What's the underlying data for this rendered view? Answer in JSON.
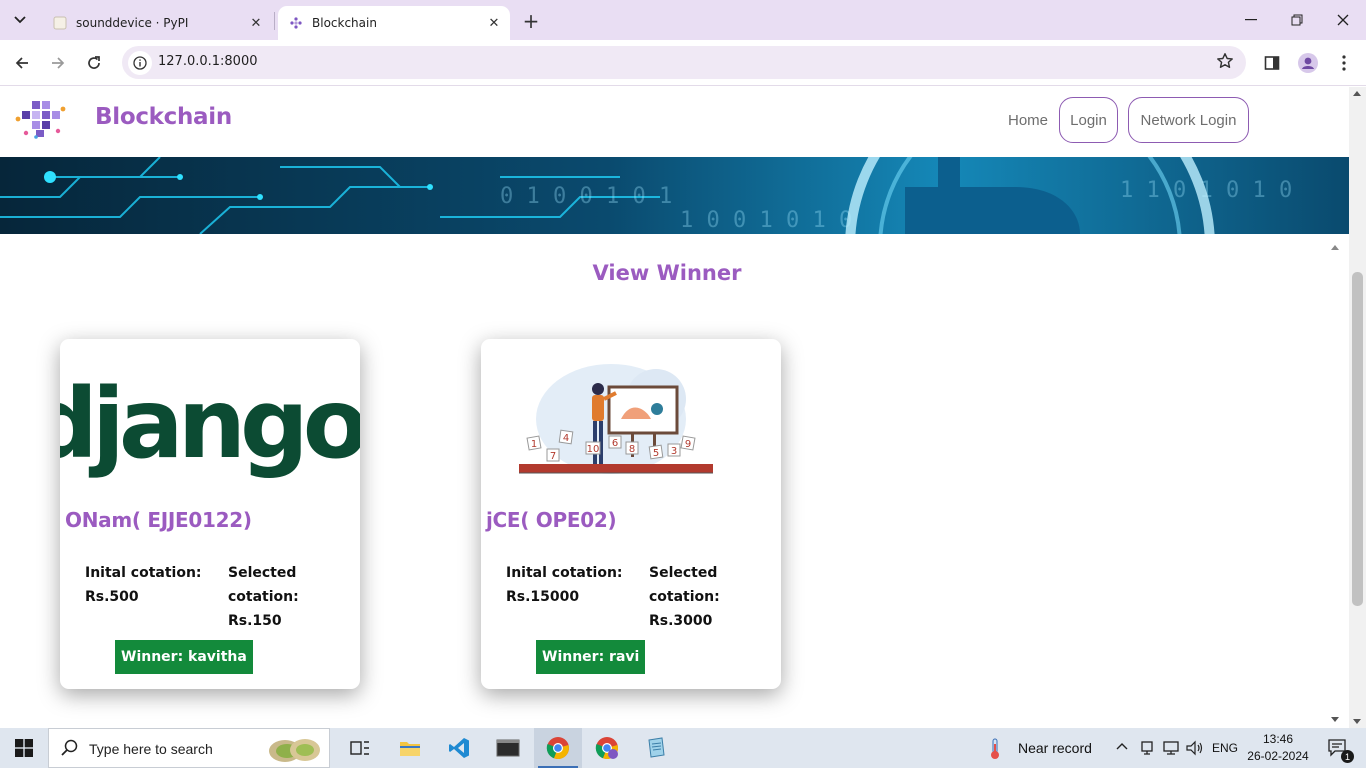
{
  "browser": {
    "tabs": [
      {
        "title": "sounddevice · PyPI",
        "active": false
      },
      {
        "title": "Blockchain",
        "active": true
      }
    ],
    "url": "127.0.0.1:8000"
  },
  "site": {
    "brand": "Blockchain",
    "nav": {
      "home": "Home",
      "login": "Login",
      "network_login": "Network Login"
    }
  },
  "page": {
    "title": "View Winner",
    "cards": [
      {
        "image": "django-logo",
        "image_text": "django",
        "name": "ONam( EJJE0122)",
        "initial_label": "Inital cotation:",
        "initial_value": "Rs.500",
        "selected_label": "Selected cotation:",
        "selected_value": "Rs.150",
        "winner": "Winner: kavitha"
      },
      {
        "image": "auction-illustration",
        "name": "jCE( OPE02)",
        "initial_label": "Inital cotation:",
        "initial_value": "Rs.15000",
        "selected_label": "Selected cotation:",
        "selected_value": "Rs.3000",
        "winner": "Winner: ravi"
      }
    ]
  },
  "taskbar": {
    "search_placeholder": "Type here to search",
    "weather": "Near record",
    "language": "ENG",
    "time": "13:46",
    "date": "26-02-2024",
    "notification_count": "1"
  },
  "colors": {
    "accent_purple": "#9b5bc0",
    "winner_green": "#138a3b",
    "django_green": "#0c4b33"
  }
}
